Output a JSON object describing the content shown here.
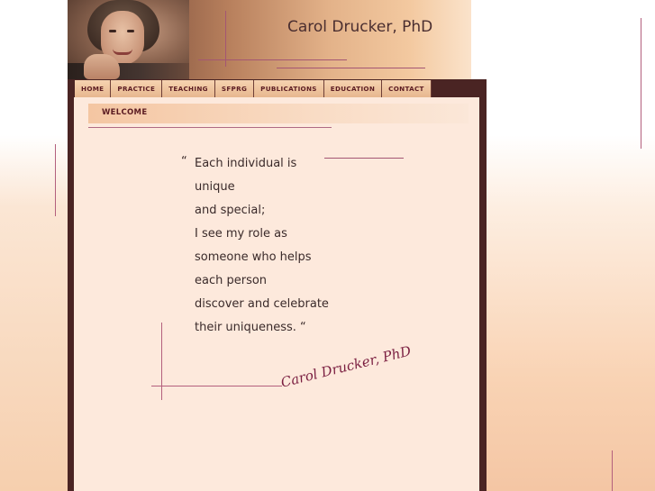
{
  "header": {
    "site_title": "Carol Drucker, PhD",
    "portrait_alt": "portrait"
  },
  "nav": {
    "items": [
      {
        "label": "Home"
      },
      {
        "label": "Practice"
      },
      {
        "label": "Teaching"
      },
      {
        "label": "Sfprg"
      },
      {
        "label": "Publications"
      },
      {
        "label": "Education"
      },
      {
        "label": "Contact"
      }
    ]
  },
  "main": {
    "section_title": "Welcome",
    "quote_open": "“",
    "quote_lines": [
      "Each individual is",
      "unique",
      "and special;",
      "I see my role as",
      "someone who helps",
      "each person",
      "discover and celebrate",
      "their uniqueness. “"
    ],
    "signature": "Carol Drucker, PhD"
  },
  "colors": {
    "accent": "#5b1c22",
    "panel": "#4a2423",
    "content_bg": "#fde9dc",
    "signature": "#7a1e40"
  }
}
